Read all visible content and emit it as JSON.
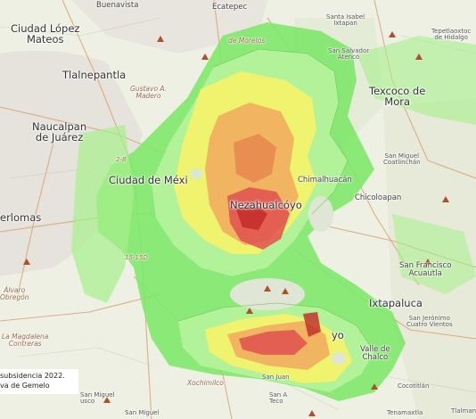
{
  "map": {
    "places": {
      "buenavista": "Buenavista",
      "ecatepec": "Ecatepec",
      "ciudad_lopez_mateos": "Ciudad López\nMateos",
      "santa_isabel_ixtapan": "Santa Isabel\nIxtapan",
      "tepetlaoxtoc": "Tepetlaoxtoc\nde Hidalgo",
      "san_salvador_atenco": "San Salvador\nAtenco",
      "tlalnepantla": "Tlalnepantla",
      "gustavo_madero": "Gustavo A.\nMadero",
      "de_morelos": "de Morelos",
      "texcoco_de_mora": "Texcoco de\nMora",
      "naucalpan": "Naucalpan\nde Juárez",
      "san_miguel_coatlinchan": "San Miguel\nCoatlinchán",
      "ciudad_de_mexico": "Ciudad de Méxi",
      "netzahualcoyotl": "Nezahualcóyo",
      "chimalhuacan": "Chimalhuacán",
      "chicoloapan": "Chicoloapan",
      "huixquilucan_edge": "erlomas",
      "ixtapaluca": "Ixtapaluca",
      "san_francisco_acuautla": "San Francisco\nAcuautla",
      "alvaro_obregon": "Álvaro\nObregón",
      "la_magdalena_contreras": "La Magdalena\nContreras",
      "san_jeronimo": "San Jerónimo\nCuatro Vientos",
      "xochimilco": "Xochimilco",
      "san_juan": "San Juan",
      "san_miguel_sw": "San Miguel\nusco",
      "san_miguel_bottom": "San Miguel",
      "tecomitl_frag": "San A\nTeco",
      "cocotitlan": "Cocotitlán",
      "tenamaxtla": "Tenamaxtla",
      "tlalmanalco": "Tlalman",
      "ayotla_frag": "yo",
      "chalco_frag": "Valle de\nChalco",
      "road_15": "15-15D",
      "road_2": "2-B"
    },
    "legend": {
      "line1": "subsidencia 2022.",
      "line2": "va de Gemelo"
    },
    "colors": {
      "base": "#eef0e4",
      "water_gray": "#d9ddd2",
      "green_low": "#7ee86a",
      "green_light": "#b4f29a",
      "yellow": "#f2f26a",
      "orange": "#f0b060",
      "red": "#e05050",
      "dark_red": "#c02828",
      "peak_marker": "#a04020"
    }
  }
}
